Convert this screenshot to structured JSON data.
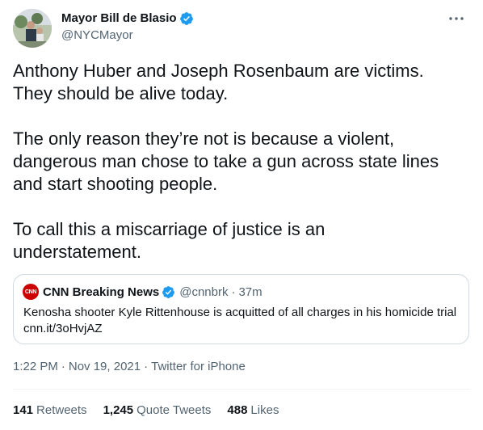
{
  "author": {
    "display_name": "Mayor Bill de Blasio",
    "handle": "@NYCMayor",
    "avatar_icon": "profile-photo",
    "verified_icon": "verified-badge-icon"
  },
  "more_icon": "more-options-icon",
  "tweet": {
    "text": "Anthony Huber and Joseph Rosenbaum are victims.\nThey should be alive today.\n\nThe only reason they’re not is because a violent,\ndangerous man chose to take a gun across state lines\nand start shooting people.\n\nTo call this a miscarriage of justice is an\nunderstatement."
  },
  "quote": {
    "avatar_text": "CNN",
    "name": "CNN Breaking News",
    "handle": "@cnnbrk",
    "dot": "·",
    "time": "37m",
    "text": "Kenosha shooter Kyle Rittenhouse is acquitted of all charges in his homicide trial\ncnn.it/3oHvjAZ"
  },
  "meta": {
    "time": "1:22 PM",
    "date": "Nov 19, 2021",
    "sep": "·",
    "source": "Twitter for iPhone"
  },
  "stats": [
    {
      "count": "141",
      "label": "Retweets"
    },
    {
      "count": "1,245",
      "label": "Quote Tweets"
    },
    {
      "count": "488",
      "label": "Likes"
    }
  ],
  "colors": {
    "verified": "#1d9bf0",
    "secondary_text": "#536471",
    "border": "#cfd9de",
    "cnn_red": "#cc0000"
  }
}
